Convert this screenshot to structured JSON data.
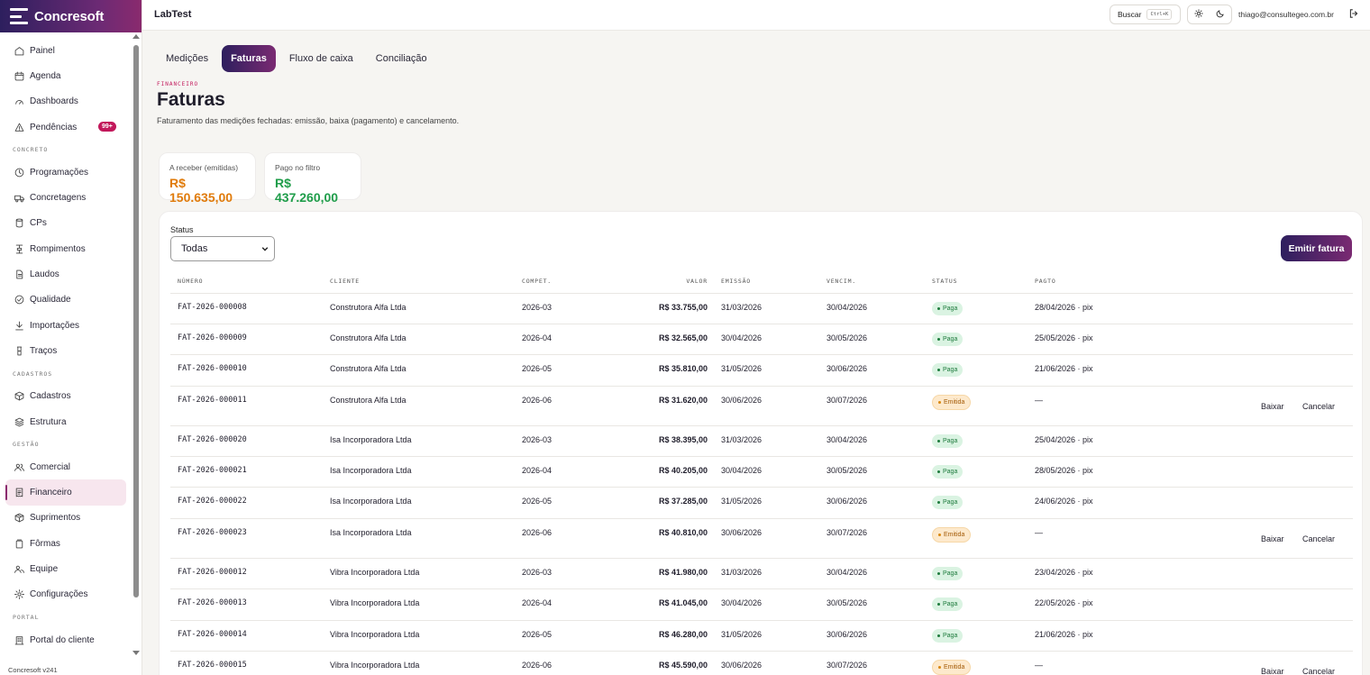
{
  "brand": {
    "name": "Concresoft"
  },
  "version": "Concresoft v241",
  "topbar": {
    "title": "LabTest",
    "search_label": "Buscar",
    "search_kbd": "Ctrl+K",
    "user_email": "thiago@consultegeo.com.br"
  },
  "sidebar": {
    "items": [
      {
        "label": "Painel",
        "icon": "home-icon"
      },
      {
        "label": "Agenda",
        "icon": "calendar-icon"
      },
      {
        "label": "Dashboards",
        "icon": "gauge-icon"
      },
      {
        "label": "Pendências",
        "icon": "alert-triangle-icon",
        "badge": "99+"
      }
    ],
    "sections": [
      {
        "title": "CONCRETO",
        "items": [
          {
            "label": "Programações",
            "icon": "clock-icon"
          },
          {
            "label": "Concretagens",
            "icon": "truck-icon"
          },
          {
            "label": "CPs",
            "icon": "cylinder-icon"
          },
          {
            "label": "Rompimentos",
            "icon": "press-icon"
          },
          {
            "label": "Laudos",
            "icon": "file-icon"
          },
          {
            "label": "Qualidade",
            "icon": "check-circle-icon"
          },
          {
            "label": "Importações",
            "icon": "download-icon"
          },
          {
            "label": "Traços",
            "icon": "beaker-icon"
          }
        ]
      },
      {
        "title": "CADASTROS",
        "items": [
          {
            "label": "Cadastros",
            "icon": "box-icon"
          },
          {
            "label": "Estrutura",
            "icon": "layers-icon"
          }
        ]
      },
      {
        "title": "GESTÃO",
        "items": [
          {
            "label": "Comercial",
            "icon": "users-icon"
          },
          {
            "label": "Financeiro",
            "icon": "receipt-icon",
            "active": true
          },
          {
            "label": "Suprimentos",
            "icon": "package-icon"
          },
          {
            "label": "Fôrmas",
            "icon": "mold-icon"
          },
          {
            "label": "Equipe",
            "icon": "team-icon"
          },
          {
            "label": "Configurações",
            "icon": "gear-icon"
          }
        ]
      },
      {
        "title": "PORTAL",
        "items": [
          {
            "label": "Portal do cliente",
            "icon": "building-icon"
          }
        ]
      }
    ]
  },
  "tabs": [
    {
      "label": "Medições",
      "active": false
    },
    {
      "label": "Faturas",
      "active": true
    },
    {
      "label": "Fluxo de caixa",
      "active": false
    },
    {
      "label": "Conciliação",
      "active": false
    }
  ],
  "page": {
    "eyebrow": "FINANCEIRO",
    "title": "Faturas",
    "subtitle": "Faturamento das medições fechadas: emissão, baixa (pagamento) e cancelamento."
  },
  "kpis": [
    {
      "label": "A receber (emitidas)",
      "value": "R$ 150.635,00",
      "color": "#e07b0b"
    },
    {
      "label": "Pago no filtro",
      "value": "R$ 437.260,00",
      "color": "#1f9d4a"
    }
  ],
  "filter": {
    "label": "Status",
    "value": "Todas"
  },
  "emit_button": "Emitir fatura",
  "table": {
    "headers": [
      "NÚMERO",
      "CLIENTE",
      "COMPET.",
      "VALOR",
      "EMISSÃO",
      "VENCIM.",
      "STATUS",
      "PAGTO"
    ],
    "rows": [
      {
        "numero": "FAT-2026-000008",
        "cliente": "Construtora Alfa Ltda",
        "compet": "2026-03",
        "valor": "R$ 33.755,00",
        "emissao": "31/03/2026",
        "vencim": "30/04/2026",
        "status": "Paga",
        "pagto": "28/04/2026 · pix"
      },
      {
        "numero": "FAT-2026-000009",
        "cliente": "Construtora Alfa Ltda",
        "compet": "2026-04",
        "valor": "R$ 32.565,00",
        "emissao": "30/04/2026",
        "vencim": "30/05/2026",
        "status": "Paga",
        "pagto": "25/05/2026 · pix"
      },
      {
        "numero": "FAT-2026-000010",
        "cliente": "Construtora Alfa Ltda",
        "compet": "2026-05",
        "valor": "R$ 35.810,00",
        "emissao": "31/05/2026",
        "vencim": "30/06/2026",
        "status": "Paga",
        "pagto": "21/06/2026 · pix"
      },
      {
        "numero": "FAT-2026-000011",
        "cliente": "Construtora Alfa Ltda",
        "compet": "2026-06",
        "valor": "R$ 31.620,00",
        "emissao": "30/06/2026",
        "vencim": "30/07/2026",
        "status": "Emitida",
        "pagto": "—",
        "actions": [
          "Baixar",
          "Cancelar"
        ]
      },
      {
        "numero": "FAT-2026-000020",
        "cliente": "Isa Incorporadora Ltda",
        "compet": "2026-03",
        "valor": "R$ 38.395,00",
        "emissao": "31/03/2026",
        "vencim": "30/04/2026",
        "status": "Paga",
        "pagto": "25/04/2026 · pix"
      },
      {
        "numero": "FAT-2026-000021",
        "cliente": "Isa Incorporadora Ltda",
        "compet": "2026-04",
        "valor": "R$ 40.205,00",
        "emissao": "30/04/2026",
        "vencim": "30/05/2026",
        "status": "Paga",
        "pagto": "28/05/2026 · pix"
      },
      {
        "numero": "FAT-2026-000022",
        "cliente": "Isa Incorporadora Ltda",
        "compet": "2026-05",
        "valor": "R$ 37.285,00",
        "emissao": "31/05/2026",
        "vencim": "30/06/2026",
        "status": "Paga",
        "pagto": "24/06/2026 · pix"
      },
      {
        "numero": "FAT-2026-000023",
        "cliente": "Isa Incorporadora Ltda",
        "compet": "2026-06",
        "valor": "R$ 40.810,00",
        "emissao": "30/06/2026",
        "vencim": "30/07/2026",
        "status": "Emitida",
        "pagto": "—",
        "actions": [
          "Baixar",
          "Cancelar"
        ]
      },
      {
        "numero": "FAT-2026-000012",
        "cliente": "Vibra Incorporadora Ltda",
        "compet": "2026-03",
        "valor": "R$ 41.980,00",
        "emissao": "31/03/2026",
        "vencim": "30/04/2026",
        "status": "Paga",
        "pagto": "23/04/2026 · pix"
      },
      {
        "numero": "FAT-2026-000013",
        "cliente": "Vibra Incorporadora Ltda",
        "compet": "2026-04",
        "valor": "R$ 41.045,00",
        "emissao": "30/04/2026",
        "vencim": "30/05/2026",
        "status": "Paga",
        "pagto": "22/05/2026 · pix"
      },
      {
        "numero": "FAT-2026-000014",
        "cliente": "Vibra Incorporadora Ltda",
        "compet": "2026-05",
        "valor": "R$ 46.280,00",
        "emissao": "31/05/2026",
        "vencim": "30/06/2026",
        "status": "Paga",
        "pagto": "21/06/2026 · pix"
      },
      {
        "numero": "FAT-2026-000015",
        "cliente": "Vibra Incorporadora Ltda",
        "compet": "2026-06",
        "valor": "R$ 45.590,00",
        "emissao": "30/06/2026",
        "vencim": "30/07/2026",
        "status": "Emitida",
        "pagto": "—",
        "actions": [
          "Baixar",
          "Cancelar"
        ]
      }
    ]
  }
}
